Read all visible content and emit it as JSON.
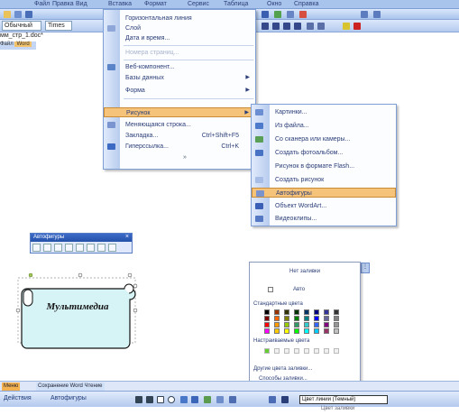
{
  "menubar": {
    "items": [
      "Файл",
      "Правка",
      "Вид",
      "Вставка",
      "Формат",
      "Сервис",
      "Таблица",
      "Окно",
      "Справка"
    ]
  },
  "toolbar": {
    "style_value": "Обычный",
    "font_value": "Times"
  },
  "document_tab": "мм_стр_1.doc*",
  "document_tab2_prefix": "Файл",
  "document_tab2_highlight": "Word",
  "insert_menu": {
    "items": [
      {
        "label": "Горизонтальная линия",
        "shortcut": "",
        "arrow": false,
        "disabled": false,
        "selected": false
      },
      {
        "label": "Слой",
        "shortcut": "",
        "arrow": false,
        "disabled": false,
        "selected": false
      },
      {
        "label": "Дата и время...",
        "shortcut": "",
        "arrow": false,
        "disabled": false,
        "selected": false
      },
      {
        "label": "Номера страниц...",
        "shortcut": "",
        "arrow": false,
        "disabled": true,
        "selected": false
      },
      {
        "label": "Веб-компонент...",
        "shortcut": "",
        "arrow": false,
        "disabled": false,
        "selected": false
      },
      {
        "label": "Базы данных",
        "shortcut": "",
        "arrow": true,
        "disabled": false,
        "selected": false
      },
      {
        "label": "Форма",
        "shortcut": "",
        "arrow": true,
        "disabled": false,
        "selected": false
      },
      {
        "label": "Рисунок",
        "shortcut": "",
        "arrow": true,
        "disabled": false,
        "selected": true
      },
      {
        "label": "Меняющаяся строка...",
        "shortcut": "",
        "arrow": false,
        "disabled": false,
        "selected": false
      },
      {
        "label": "Закладка...",
        "shortcut": "Ctrl+Shift+F5",
        "arrow": false,
        "disabled": false,
        "selected": false
      },
      {
        "label": "Гиперссылка...",
        "shortcut": "Ctrl+K",
        "arrow": false,
        "disabled": false,
        "selected": false
      }
    ],
    "expand_glyph": "»"
  },
  "picture_menu": {
    "items": [
      {
        "label": "Картинки...",
        "selected": false
      },
      {
        "label": "Из файла...",
        "selected": false
      },
      {
        "label": "Со сканера или камеры...",
        "selected": false
      },
      {
        "label": "Создать фотоальбом...",
        "selected": false
      },
      {
        "label": "Рисунок в формате Flash...",
        "selected": false
      },
      {
        "label": "Создать рисунок",
        "selected": false
      },
      {
        "label": "Автофигуры",
        "selected": true
      },
      {
        "label": "Объект WordArt...",
        "selected": false
      },
      {
        "label": "Видеоклипы...",
        "selected": false
      }
    ]
  },
  "autoshapes_toolbar": {
    "title": "Автофигуры",
    "close": "×"
  },
  "scroll_text": "Мультимедиа",
  "color_popup": {
    "no_fill": "Нет заливки",
    "auto": "Авто",
    "standard_colors": "Стандартные цвета",
    "custom_colors": "Настраиваемые цвета",
    "more_colors": "Другие цвета заливки...",
    "fill_effects": "Способы заливки...",
    "standard_swatches": [
      "#000000",
      "#993300",
      "#333300",
      "#003300",
      "#003366",
      "#000080",
      "#333399",
      "#333333",
      "#800000",
      "#ff6600",
      "#808000",
      "#008000",
      "#008080",
      "#0000ff",
      "#666699",
      "#808080",
      "#ff0000",
      "#ff9900",
      "#99cc00",
      "#339966",
      "#33cccc",
      "#3366ff",
      "#800080",
      "#969696",
      "#ff00ff",
      "#ffcc00",
      "#ffff00",
      "#00ff00",
      "#00ffff",
      "#00ccff",
      "#993366",
      "#c0c0c0"
    ],
    "custom_first": "#66cc33"
  },
  "bottom_tabs": [
    "Меню",
    "Сохранение Word Чтение"
  ],
  "drawbar": {
    "actions_label": "Действия",
    "autoshapes_label": "Автофигуры",
    "linecolor_tip": "Цвет линии (Темный)"
  },
  "below_tip": "Цвет заливки"
}
